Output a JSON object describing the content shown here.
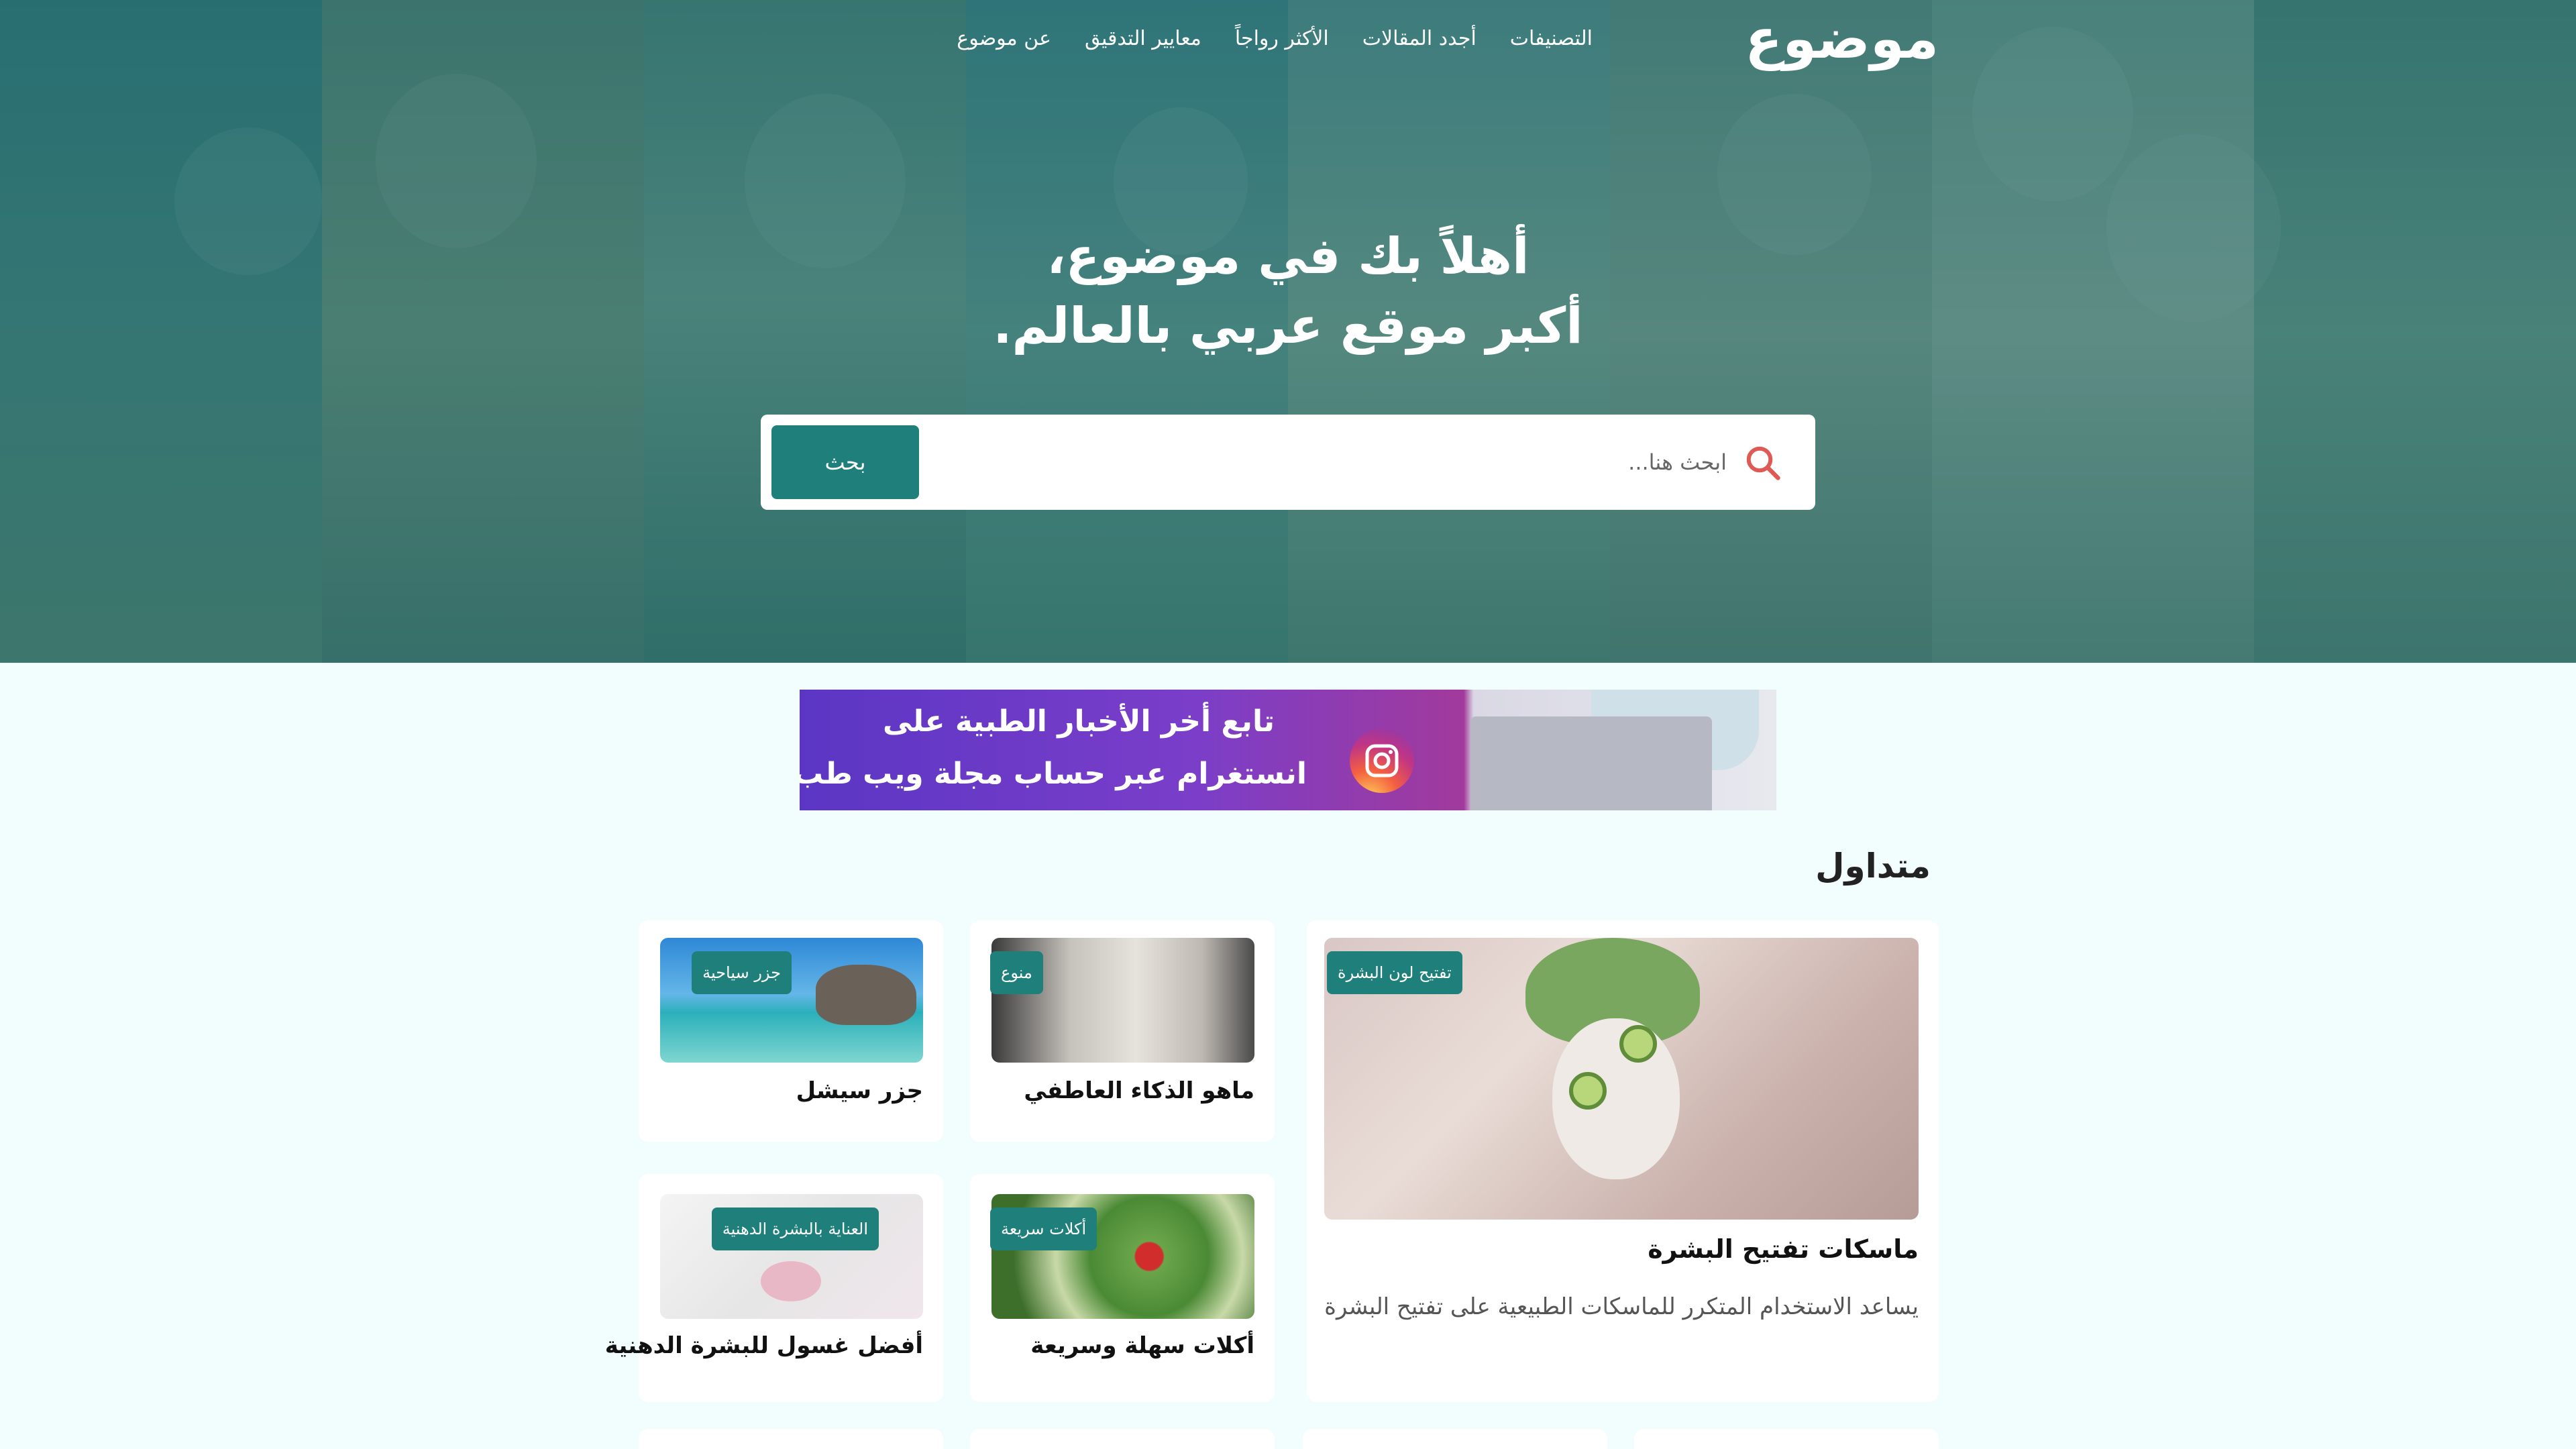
{
  "site": {
    "logo": "موضوع",
    "nav": [
      {
        "label": "التصنيفات"
      },
      {
        "label": "أجدد المقالات"
      },
      {
        "label": "الأكثر رواجاً"
      },
      {
        "label": "معايير التدقيق"
      },
      {
        "label": "عن موضوع"
      }
    ]
  },
  "hero": {
    "title_line1": "أهلاً بك في موضوع،",
    "title_line2": "أكبر موقع عربي بالعالم."
  },
  "search": {
    "placeholder": "ابحث هنا...",
    "button_label": "بحث",
    "icon": "search-icon"
  },
  "ad": {
    "line1": "تابع أخر الأخبار الطبية على",
    "line2": "انستغرام عبر حساب مجلة ويب طب"
  },
  "trending": {
    "title": "متداول",
    "featured": {
      "badge": "تفتيح لون البشرة",
      "title": "ماسكات تفتيح البشرة",
      "description": "يساعد الاستخدام المتكرر للماسكات الطبيعية على تفتيح البشرة"
    },
    "cards": [
      {
        "badge": "منوع",
        "title": "ماهو الذكاء العاطفي"
      },
      {
        "badge": "جزر سياحية",
        "title": "جزر سيشل"
      },
      {
        "badge": "أكلات سريعة",
        "title": "أكلات سهلة وسريعة"
      },
      {
        "badge": "العناية بالبشرة الدهنية",
        "title": "أفضل غسول للبشرة الدهنية"
      }
    ]
  },
  "colors": {
    "accent": "#1f7f7b",
    "hero_overlay": "#166260",
    "page_background": "#f2fdfd"
  }
}
